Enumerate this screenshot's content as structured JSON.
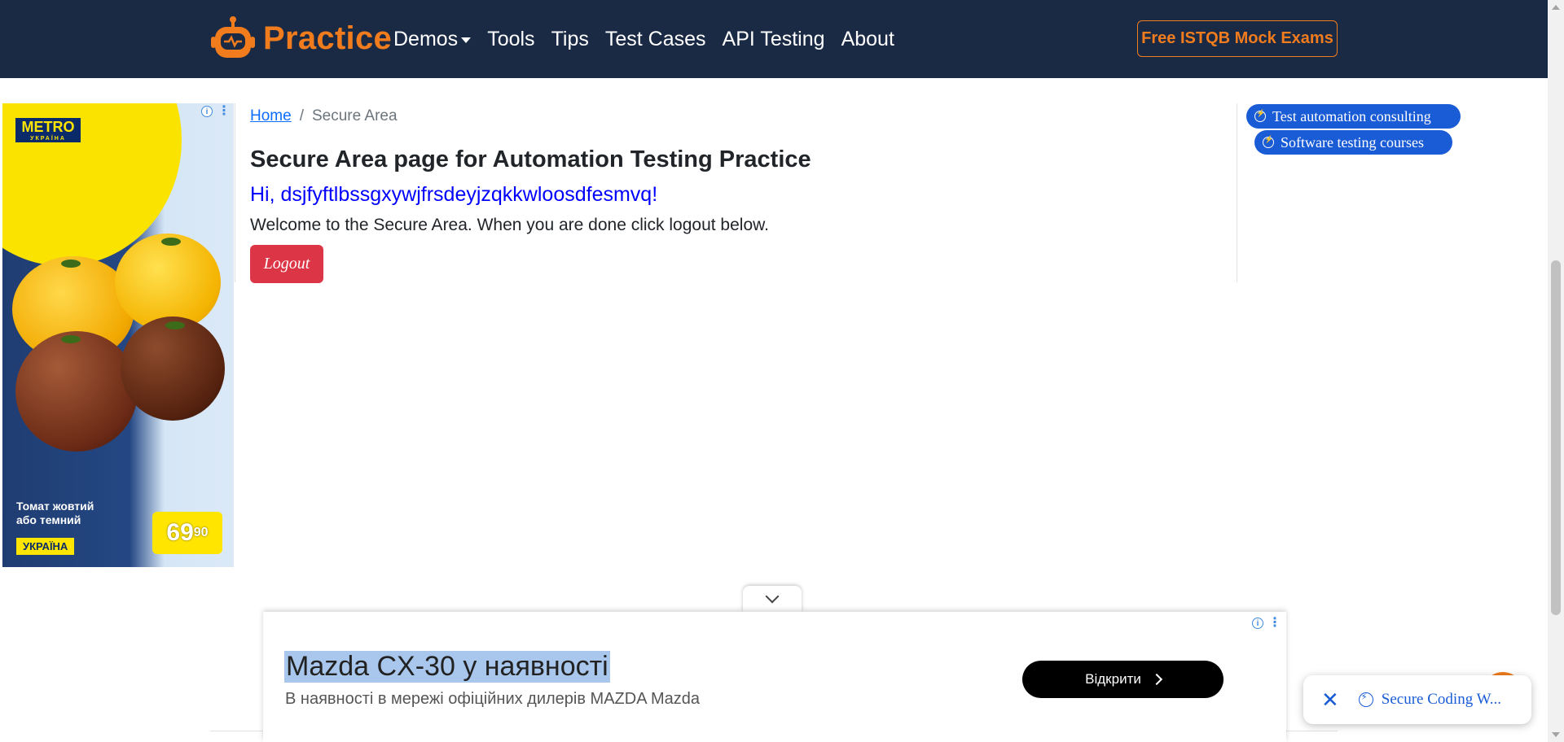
{
  "navbar": {
    "brand": "Practice",
    "links": [
      {
        "label": "Demos",
        "dropdown": true
      },
      {
        "label": "Tools"
      },
      {
        "label": "Tips"
      },
      {
        "label": "Test Cases"
      },
      {
        "label": "API Testing"
      },
      {
        "label": "About"
      }
    ],
    "cta": "Free ISTQB Mock Exams"
  },
  "breadcrumb": {
    "home": "Home",
    "separator": "/",
    "current": "Secure Area"
  },
  "main": {
    "title": "Secure Area page for Automation Testing Practice",
    "greeting": "Hi, dsjfyftlbssgxywjfrsdeyjzqkkwloosdfesmvq!",
    "welcome": "Welcome to the Secure Area. When you are done click logout below.",
    "logout_label": "Logout"
  },
  "right_links": [
    "Test automation consulting",
    "Software testing courses"
  ],
  "left_ad": {
    "brand": "METRO",
    "brand_sub": "УКРАЇНА",
    "caption_line1": "Томат жовтий",
    "caption_line2": "або темний",
    "tag": "УКРАЇНА",
    "price_main": "69",
    "price_cents": "90"
  },
  "bottom_ad": {
    "headline": "Mazda CX-30 у наявності",
    "subtitle": "В наявності в мережі офіційних дилерів MAZDA Mazda",
    "button": "Відкрити"
  },
  "toast": {
    "text": "Secure Coding W..."
  },
  "colors": {
    "navbar_bg": "#1b2a44",
    "brand_orange": "#f07c1e",
    "link_blue": "#0d6efd",
    "greeting_blue": "#0000ff",
    "logout_red": "#dc3545",
    "pill_blue": "#1a5cd6"
  },
  "icons": {
    "brand_logo": "robot-icon",
    "ad_info": "info-icon",
    "ad_menu": "kebab-icon",
    "pill": "bolt-circle-icon",
    "collapse": "chevron-down-icon",
    "toast_close": "close-icon"
  }
}
